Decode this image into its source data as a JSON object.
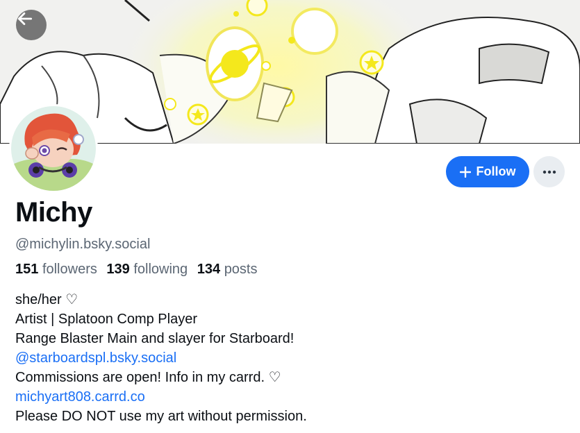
{
  "profile": {
    "display_name": "Michy",
    "handle": "@michylin.bsky.social",
    "stats": {
      "followers_count": "151",
      "followers_label": "followers",
      "following_count": "139",
      "following_label": "following",
      "posts_count": "134",
      "posts_label": "posts"
    }
  },
  "actions": {
    "back_icon": "arrow-left-icon",
    "follow_label": "Follow",
    "follow_icon": "plus-icon",
    "more_icon": "ellipsis-icon"
  },
  "bio": {
    "line1": "she/her ♡",
    "line2": "Artist | Splatoon Comp Player",
    "line3": "Range Blaster Main and slayer for Starboard!",
    "link1": "@starboardspl.bsky.social",
    "line5": "Commissions are open! Info in my carrd. ♡",
    "link2": "michyart808.carrd.co",
    "line7": "Please DO NOT use my art without permission."
  },
  "colors": {
    "accent": "#1a6ff5",
    "muted_text": "#5b6673",
    "button_gray": "#e9edf1"
  }
}
